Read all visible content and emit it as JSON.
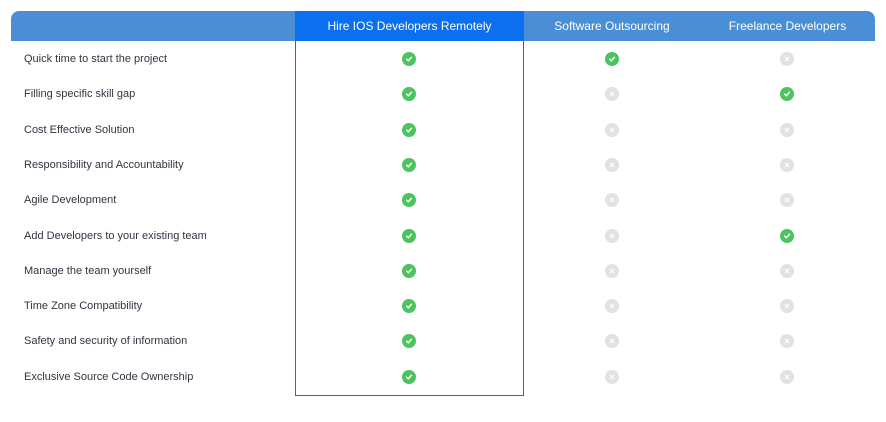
{
  "header": {
    "col_highlight": "Hire IOS Developers Remotely",
    "col_2": "Software Outsourcing",
    "col_3": "Freelance Developers"
  },
  "colors": {
    "header_bg": "#4a8fd6",
    "highlight_bg": "#0b6ff0",
    "check": "#4cc35f",
    "cross": "#e2e2e2"
  },
  "rows": [
    {
      "label": "Quick time to start the project",
      "values": [
        "yes",
        "yes",
        "no"
      ]
    },
    {
      "label": "Filling specific skill gap",
      "values": [
        "yes",
        "no",
        "yes"
      ]
    },
    {
      "label": "Cost Effective Solution",
      "values": [
        "yes",
        "no",
        "no"
      ]
    },
    {
      "label": "Responsibility and Accountability",
      "values": [
        "yes",
        "no",
        "no"
      ]
    },
    {
      "label": "Agile Development",
      "values": [
        "yes",
        "no",
        "no"
      ]
    },
    {
      "label": "Add Developers to your existing team",
      "values": [
        "yes",
        "no",
        "yes"
      ]
    },
    {
      "label": "Manage the team yourself",
      "values": [
        "yes",
        "no",
        "no"
      ]
    },
    {
      "label": "Time Zone Compatibility",
      "values": [
        "yes",
        "no",
        "no"
      ]
    },
    {
      "label": "Safety and security of information",
      "values": [
        "yes",
        "no",
        "no"
      ]
    },
    {
      "label": "Exclusive Source Code Ownership",
      "values": [
        "yes",
        "no",
        "no"
      ]
    }
  ]
}
